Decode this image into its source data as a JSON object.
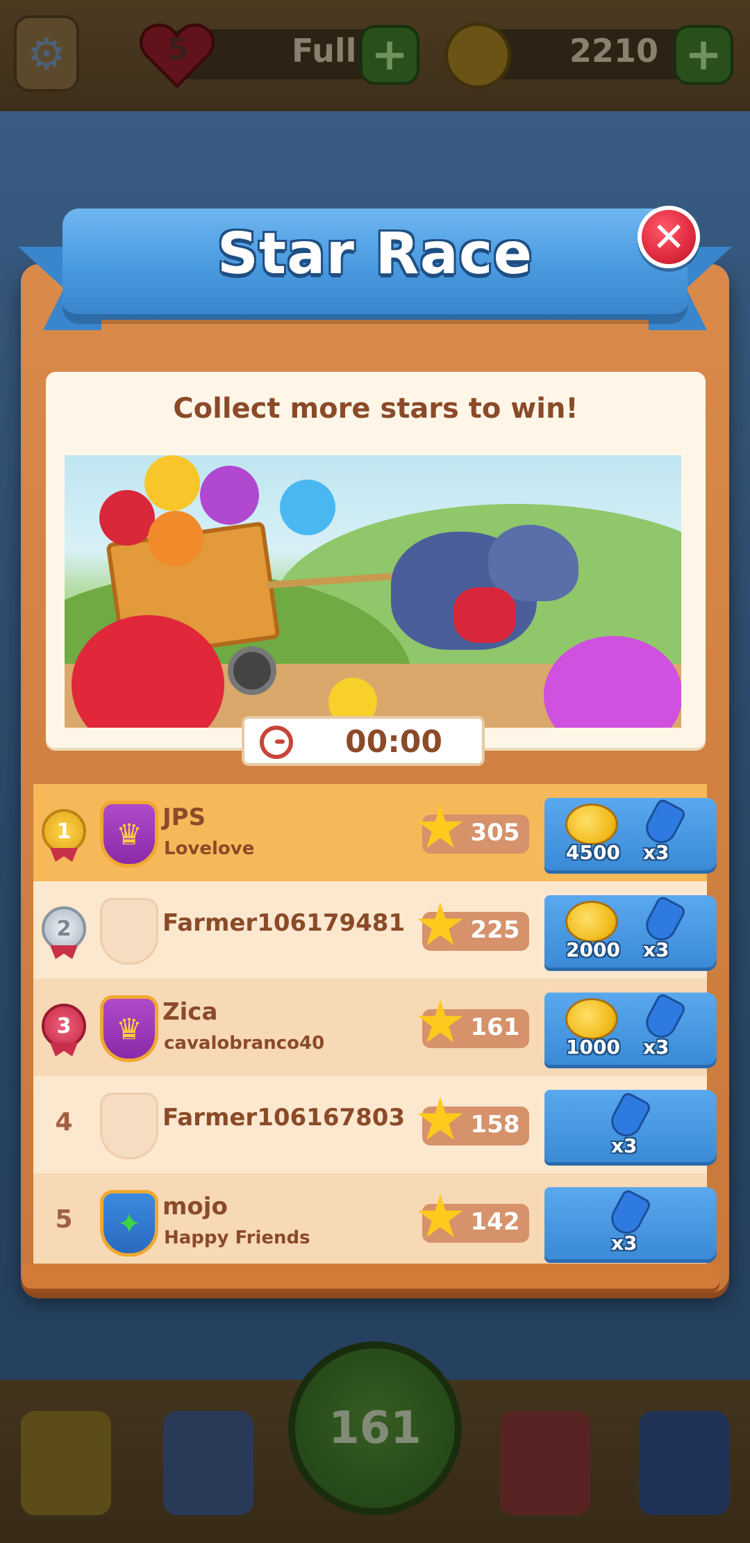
{
  "hud": {
    "lives": "5",
    "lives_status": "Full",
    "coins": "2210",
    "level": "161"
  },
  "modal": {
    "title": "Star Race",
    "subtitle": "Collect more stars to win!",
    "timer": "00:00"
  },
  "leaderboard": [
    {
      "rank": "1",
      "name": "JPS",
      "team": "Lovelove",
      "stars": "305",
      "coins": "4500",
      "shovel": "x3"
    },
    {
      "rank": "2",
      "name": "Farmer106179481",
      "team": "",
      "stars": "225",
      "coins": "2000",
      "shovel": "x3"
    },
    {
      "rank": "3",
      "name": "Zica",
      "team": "cavalobranco40",
      "stars": "161",
      "coins": "1000",
      "shovel": "x3"
    },
    {
      "rank": "4",
      "name": "Farmer106167803",
      "team": "",
      "stars": "158",
      "coins": "",
      "shovel": "x3"
    },
    {
      "rank": "5",
      "name": "mojo",
      "team": "Happy Friends",
      "stars": "142",
      "coins": "",
      "shovel": "x3"
    }
  ],
  "icons": {
    "settings": "gear-icon",
    "lives": "heart-icon",
    "coins": "paw-coin-icon",
    "close": "close-icon",
    "timer": "clock-icon",
    "star": "star-icon",
    "shovel": "shovel-icon",
    "crown_badge": "crown-icon",
    "team_badge": "team-badge-icon"
  },
  "colors": {
    "title_text": "#ffffff",
    "ribbon": "#4a9ae0",
    "board": "#d98a4a",
    "first_row": "#f7b85a",
    "text_brown": "#8b4a28",
    "close_button": "#e02a3e",
    "star": "#ffc91e"
  }
}
